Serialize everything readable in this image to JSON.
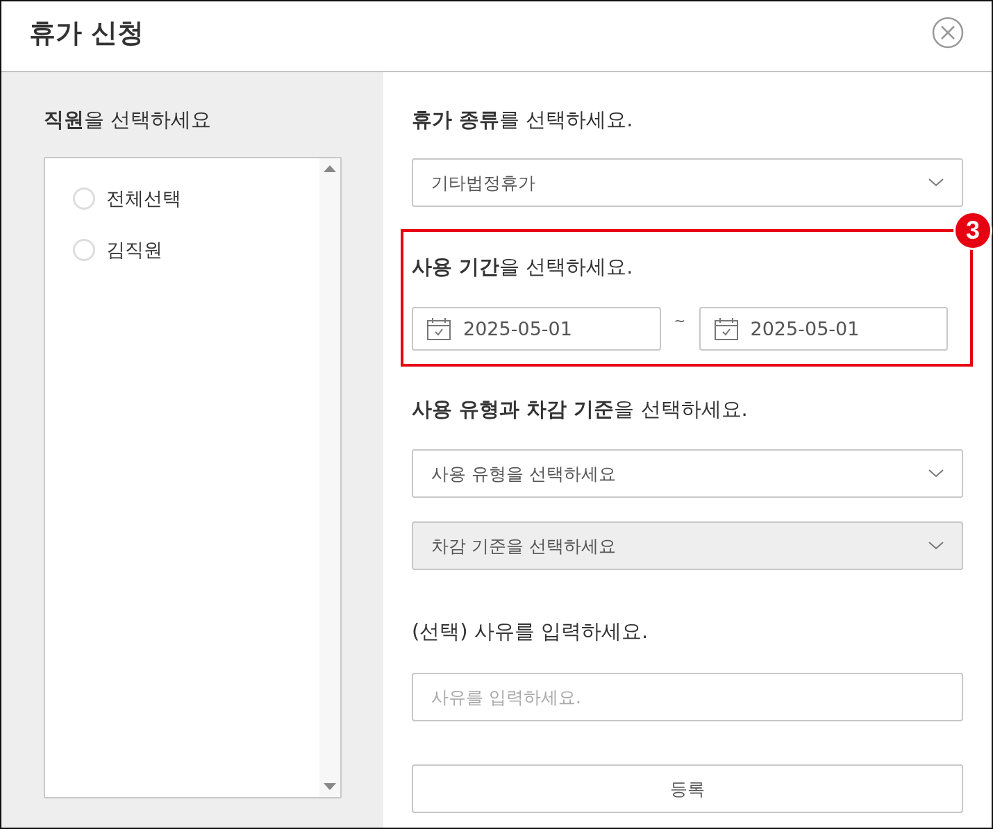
{
  "dialog": {
    "title": "휴가 신청"
  },
  "employees": {
    "heading": "**직원**을 선택하세요",
    "options": [
      {
        "label": "전체선택",
        "selected": false
      },
      {
        "label": "김직원",
        "selected": false
      }
    ]
  },
  "leave_type": {
    "heading": "**휴가 종류**를 선택하세요.",
    "value": "기타법정휴가"
  },
  "period": {
    "heading": "**사용 기간**을 선택하세요.",
    "start": "2025-05-01",
    "separator": "~",
    "end": "2025-05-01",
    "highlighted": true,
    "badge": "3"
  },
  "usage": {
    "heading": "**사용 유형과 차감 기준**을 선택하세요.",
    "selects": [
      {
        "placeholder": "사용 유형을 선택하세요",
        "disabled": false
      },
      {
        "placeholder": "차감 기준을 선택하세요",
        "disabled": true
      }
    ]
  },
  "reason": {
    "heading": "(선택) 사유를 입력하세요.",
    "placeholder": "사유를 입력하세요."
  },
  "submit_button": "등록"
}
